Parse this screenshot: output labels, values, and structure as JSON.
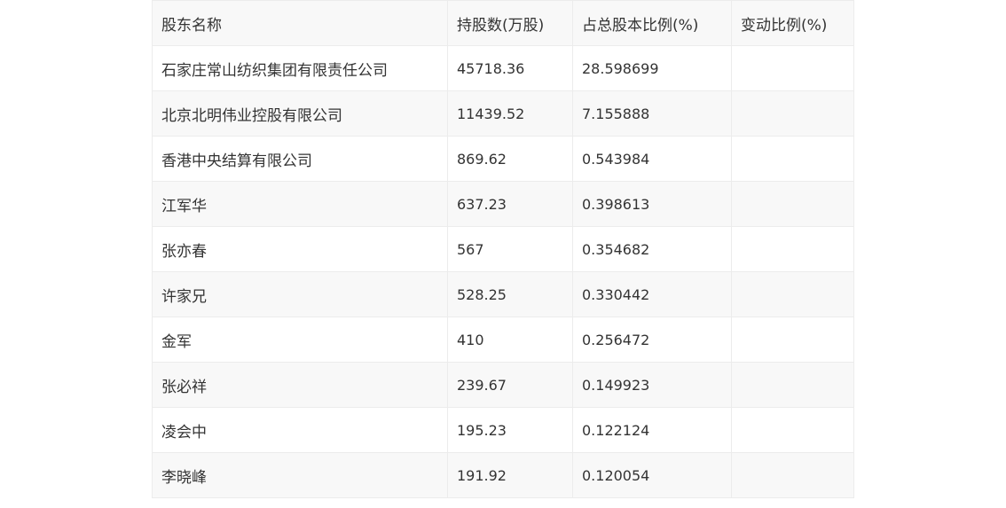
{
  "table": {
    "headers": [
      "股东名称",
      "持股数(万股)",
      "占总股本比例(%)",
      "变动比例(%)"
    ],
    "rows": [
      [
        "石家庄常山纺织集团有限责任公司",
        "45718.36",
        "28.598699",
        ""
      ],
      [
        "北京北明伟业控股有限公司",
        "11439.52",
        "7.155888",
        ""
      ],
      [
        "香港中央结算有限公司",
        "869.62",
        "0.543984",
        ""
      ],
      [
        "江军华",
        "637.23",
        "0.398613",
        ""
      ],
      [
        "张亦春",
        "567",
        "0.354682",
        ""
      ],
      [
        "许家兄",
        "528.25",
        "0.330442",
        ""
      ],
      [
        "金军",
        "410",
        "0.256472",
        ""
      ],
      [
        "张必祥",
        "239.67",
        "0.149923",
        ""
      ],
      [
        "凌会中",
        "195.23",
        "0.122124",
        ""
      ],
      [
        "李晓峰",
        "191.92",
        "0.120054",
        ""
      ]
    ]
  }
}
